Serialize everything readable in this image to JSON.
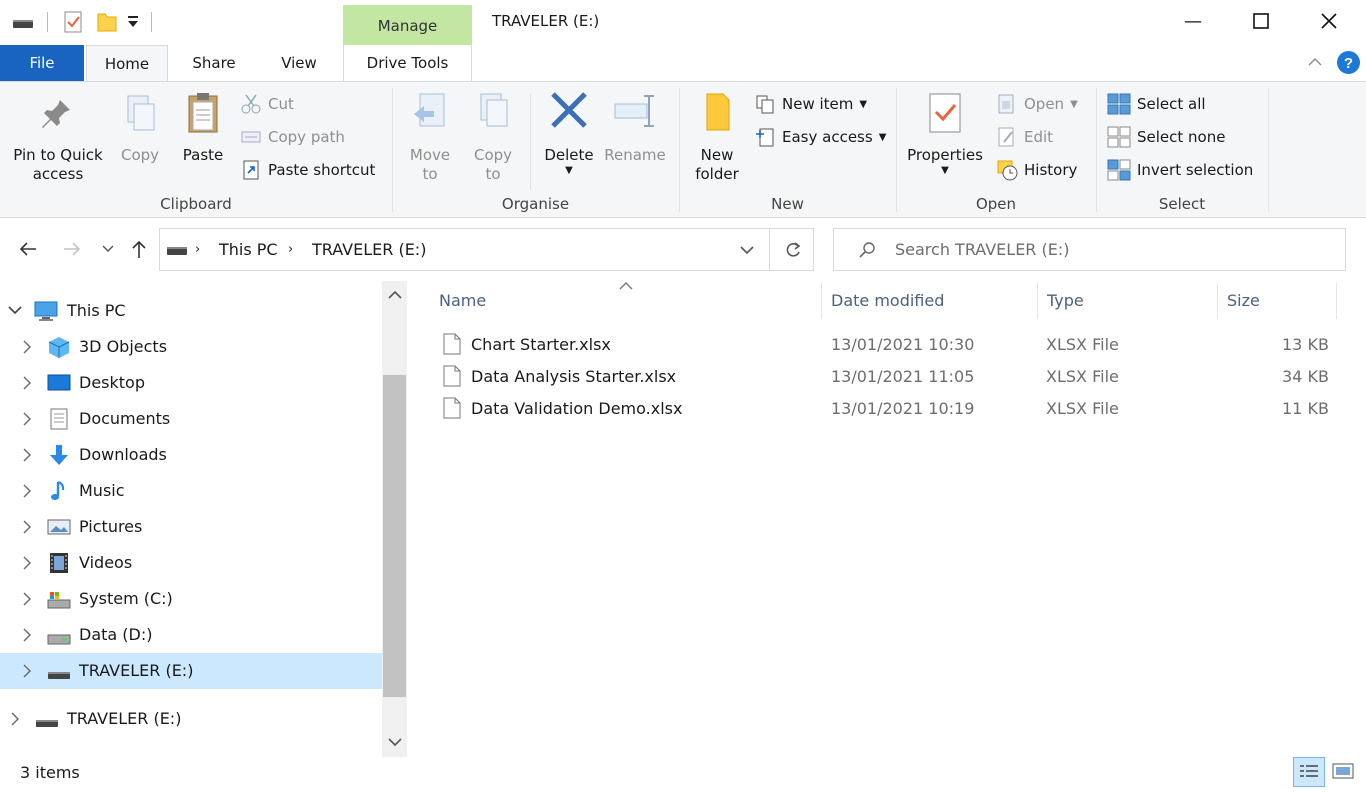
{
  "window": {
    "title": "TRAVELER (E:)",
    "contextual_tab": "Manage"
  },
  "tabs": {
    "file": "File",
    "home": "Home",
    "share": "Share",
    "view": "View",
    "drive_tools": "Drive Tools"
  },
  "ribbon": {
    "clipboard": {
      "label": "Clipboard",
      "pin_line1": "Pin to Quick",
      "pin_line2": "access",
      "copy": "Copy",
      "paste": "Paste",
      "cut": "Cut",
      "copy_path": "Copy path",
      "paste_shortcut": "Paste shortcut"
    },
    "organise": {
      "label": "Organise",
      "move_line1": "Move",
      "move_line2": "to",
      "copy_line1": "Copy",
      "copy_line2": "to",
      "delete": "Delete",
      "rename": "Rename"
    },
    "new": {
      "label": "New",
      "folder_line1": "New",
      "folder_line2": "folder",
      "new_item": "New item",
      "easy_access": "Easy access"
    },
    "open": {
      "label": "Open",
      "properties": "Properties",
      "open": "Open",
      "edit": "Edit",
      "history": "History"
    },
    "select": {
      "label": "Select",
      "select_all": "Select all",
      "select_none": "Select none",
      "invert_selection": "Invert selection"
    }
  },
  "address": {
    "crumbs": [
      "This PC",
      "TRAVELER (E:)"
    ],
    "search_placeholder": "Search TRAVELER (E:)"
  },
  "nav_tree": [
    {
      "label": "This PC",
      "icon": "computer-icon",
      "expanded": true
    },
    {
      "label": "3D Objects",
      "icon": "cube-icon"
    },
    {
      "label": "Desktop",
      "icon": "desktop-icon"
    },
    {
      "label": "Documents",
      "icon": "document-icon"
    },
    {
      "label": "Downloads",
      "icon": "download-arrow-icon"
    },
    {
      "label": "Music",
      "icon": "music-note-icon"
    },
    {
      "label": "Pictures",
      "icon": "picture-icon"
    },
    {
      "label": "Videos",
      "icon": "film-icon"
    },
    {
      "label": "System (C:)",
      "icon": "system-drive-icon"
    },
    {
      "label": "Data (D:)",
      "icon": "hard-drive-icon"
    },
    {
      "label": "TRAVELER (E:)",
      "icon": "usb-drive-icon",
      "selected": true
    },
    {
      "label": "TRAVELER (E:)",
      "icon": "usb-drive-icon"
    }
  ],
  "columns": {
    "name": "Name",
    "date": "Date modified",
    "type": "Type",
    "size": "Size"
  },
  "files": [
    {
      "name": "Chart Starter.xlsx",
      "date": "13/01/2021 10:30",
      "type": "XLSX File",
      "size": "13 KB"
    },
    {
      "name": "Data Analysis Starter.xlsx",
      "date": "13/01/2021 11:05",
      "type": "XLSX File",
      "size": "34 KB"
    },
    {
      "name": "Data Validation Demo.xlsx",
      "date": "13/01/2021 10:19",
      "type": "XLSX File",
      "size": "11 KB"
    }
  ],
  "status": {
    "item_count": "3 items"
  },
  "colors": {
    "file_tab": "#1964c0",
    "manage_tab": "#c4e6a3",
    "selection": "#cce8ff",
    "help": "#1e78d7"
  }
}
